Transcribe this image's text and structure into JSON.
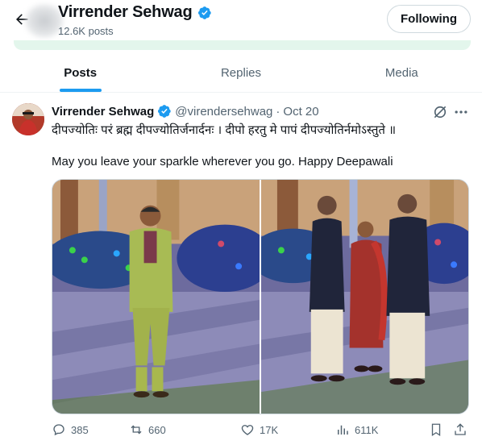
{
  "header": {
    "back_icon": "arrow-left-icon",
    "name": "Virrender Sehwag",
    "posts_count": "12.6K posts",
    "follow_button": "Following"
  },
  "tabs": [
    {
      "label": "Posts",
      "active": true
    },
    {
      "label": "Replies",
      "active": false
    },
    {
      "label": "Media",
      "active": false
    }
  ],
  "post": {
    "author": "Virrender Sehwag",
    "handle": "@virendersehwag",
    "separator": "·",
    "date": "Oct 20",
    "text_line1": "दीपज्योतिः परं ब्रह्म दीपज्योतिर्जनार्दनः । दीपो हरतु मे पापं दीपज्योतिर्नमोऽस्तुते ॥",
    "text_line2": "May you leave your sparkle wherever you go. Happy Deepawali",
    "photos": [
      {
        "description_icon": "photo-man-green-kurta"
      },
      {
        "description_icon": "photo-family-group"
      }
    ],
    "stats": {
      "replies": "385",
      "reposts": "660",
      "likes": "17K",
      "views": "611K"
    }
  },
  "colors": {
    "accent": "#1d9bf0",
    "text_primary": "#0f1419",
    "text_secondary": "#536471",
    "banner_green": "#e3f6ec"
  }
}
